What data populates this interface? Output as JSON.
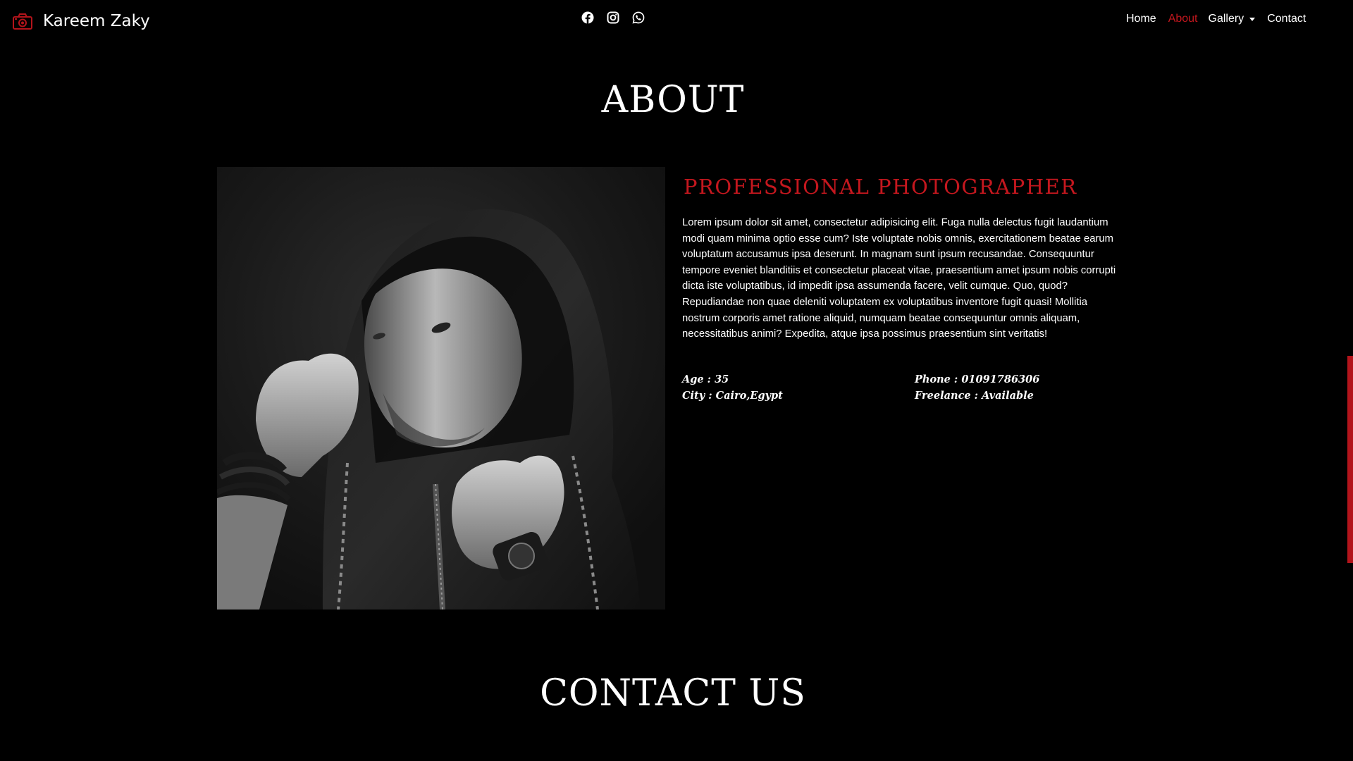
{
  "brand": {
    "name": "Kareem Zaky",
    "icon": "camera-icon"
  },
  "social": [
    {
      "name": "facebook",
      "icon": "facebook-icon"
    },
    {
      "name": "instagram",
      "icon": "instagram-icon"
    },
    {
      "name": "whatsapp",
      "icon": "whatsapp-icon"
    }
  ],
  "nav": {
    "home": "Home",
    "about": "About",
    "gallery": "Gallery",
    "contact": "Contact",
    "active": "About"
  },
  "about": {
    "title": "ABOUT",
    "subtitle": "PROFESSIONAL PHOTOGRAPHER",
    "bio": "Lorem ipsum dolor sit amet, consectetur adipisicing elit. Fuga nulla delectus fugit laudantium modi quam minima optio esse cum? Iste voluptate nobis omnis, exercitationem beatae earum voluptatum accusamus ipsa deserunt. In magnam sunt ipsum recusandae. Consequuntur tempore eveniet blanditiis et consectetur placeat vitae, praesentium amet ipsum nobis corrupti dicta iste voluptatibus, id impedit ipsa assumenda facere, velit cumque. Quo, quod? Repudiandae non quae deleniti voluptatem ex voluptatibus inventore fugit quasi! Mollitia nostrum corporis amet ratione aliquid, numquam beatae consequuntur omnis aliquam, necessitatibus animi? Expedita, atque ipsa possimus praesentium sint veritatis!",
    "details": {
      "age": "Age : 35",
      "phone": "Phone : 01091786306",
      "city": "City : Cairo,Egypt",
      "freelance": "Freelance : Available"
    }
  },
  "contact": {
    "title": "CONTACT US"
  },
  "colors": {
    "accent": "#c4171e",
    "background": "#000000",
    "text": "#ffffff"
  }
}
